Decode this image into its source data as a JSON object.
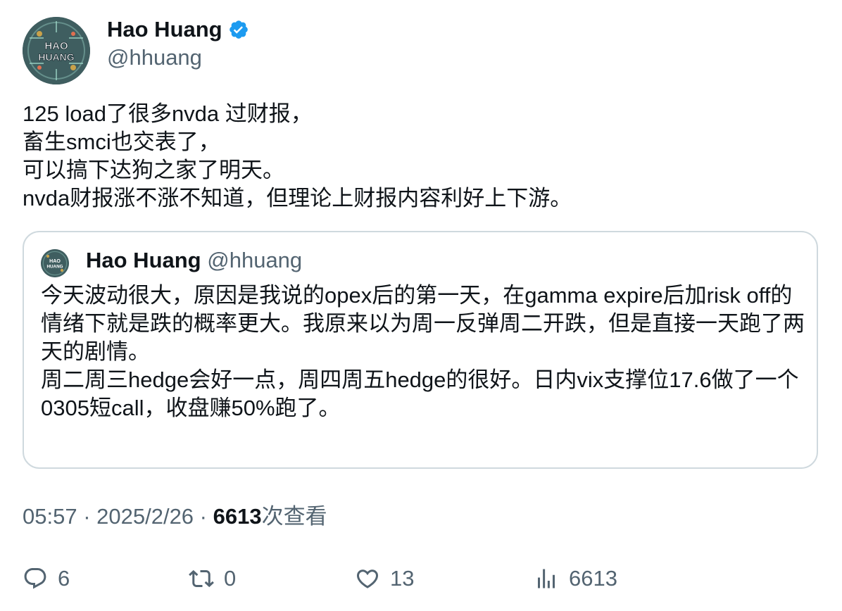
{
  "author": {
    "display_name": "Hao Huang",
    "handle": "@hhuang",
    "avatar_label": "HAO HUANG",
    "verified_color": "#1d9bf0"
  },
  "tweet": {
    "text": "125 load了很多nvda 过财报，\n畜生smci也交表了，\n可以搞下达狗之家了明天。\nnvda财报涨不涨不知道，但理论上财报内容利好上下游。"
  },
  "quote": {
    "display_name": "Hao Huang",
    "handle": "@hhuang",
    "text": "今天波动很大，原因是我说的opex后的第一天，在gamma expire后加risk off的情绪下就是跌的概率更大。我原来以为周一反弹周二开跌，但是直接一天跑了两天的剧情。\n周二周三hedge会好一点，周四周五hedge的很好。日内vix支撑位17.6做了一个0305短call，收盘赚50%跑了。"
  },
  "meta": {
    "time": "05:57",
    "separator1": " · ",
    "date": "2025/2/26",
    "separator2": " · ",
    "views_count": "6613",
    "views_label": "次查看"
  },
  "actions": {
    "reply_icon": "reply-icon",
    "reply_count": "6",
    "retweet_icon": "retweet-icon",
    "retweet_count": "0",
    "like_icon": "heart-icon",
    "like_count": "13",
    "views_icon": "bar-chart-icon",
    "views_count": "6613"
  },
  "colors": {
    "text_primary": "#0f1419",
    "text_secondary": "#536471",
    "border": "#cfd9de",
    "verified": "#1d9bf0"
  }
}
